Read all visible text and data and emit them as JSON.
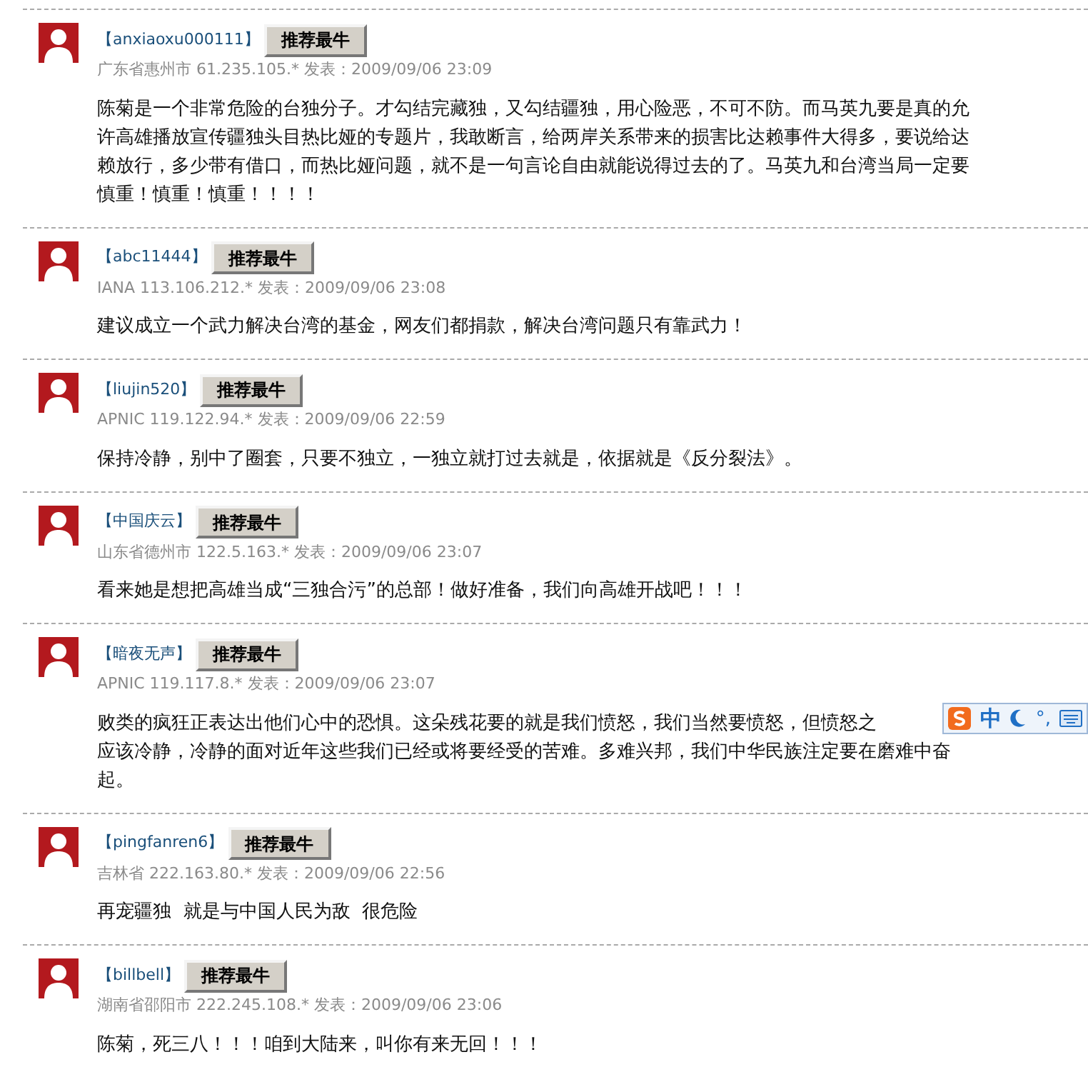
{
  "comments": [
    {
      "user": "【anxiaoxu000111】",
      "button": "推荐最牛",
      "meta": "广东省惠州市 61.235.105.* 发表：2009/09/06 23:09",
      "lines": [
        "陈菊是一个非常危险的台独分子。才勾结完藏独，又勾结疆独，用心险恶，不可不防。而马英九要是真的允",
        "许高雄播放宣传疆独头目热比娅的专题片，我敢断言，给两岸关系带来的损害比达赖事件大得多，要说给达",
        "赖放行，多少带有借口，而热比娅问题，就不是一句言论自由就能说得过去的了。马英九和台湾当局一定要",
        "慎重！慎重！慎重！！！！"
      ]
    },
    {
      "user": "【abc11444】",
      "button": "推荐最牛",
      "meta": "IANA 113.106.212.* 发表：2009/09/06 23:08",
      "lines": [
        "建议成立一个武力解决台湾的基金，网友们都捐款，解决台湾问题只有靠武力！"
      ]
    },
    {
      "user": "【liujin520】",
      "button": "推荐最牛",
      "meta": "APNIC 119.122.94.* 发表：2009/09/06 22:59",
      "lines": [
        "保持冷静，别中了圈套，只要不独立，一独立就打过去就是，依据就是《反分裂法》。"
      ]
    },
    {
      "user": "【中国庆云】",
      "button": "推荐最牛",
      "meta": "山东省德州市 122.5.163.* 发表：2009/09/06 23:07",
      "lines": [
        "看来她是想把高雄当成“三独合污”的总部！做好准备，我们向高雄开战吧！！！"
      ]
    },
    {
      "user": "【暗夜无声】",
      "button": "推荐最牛",
      "meta": "APNIC 119.117.8.* 发表：2009/09/06 23:07",
      "lines": [
        "败类的疯狂正表达出他们心中的恐惧。这朵残花要的就是我们愤怒，我们当然要愤怒，但愤怒之",
        "应该冷静，冷静的面对近年这些我们已经或将要经受的苦难。多难兴邦，我们中华民族注定要在磨难中奋",
        "起。"
      ],
      "ime": {
        "mode": "中",
        "punct": "°,"
      }
    },
    {
      "user": "【pingfanren6】",
      "button": "推荐最牛",
      "meta": "吉林省 222.163.80.* 发表：2009/09/06 22:56",
      "lines": [
        "再宠疆独  就是与中国人民为敌  很危险"
      ]
    },
    {
      "user": "【billbell】",
      "button": "推荐最牛",
      "meta": "湖南省邵阳市 222.245.108.* 发表：2009/09/06 23:06",
      "lines": [
        "陈菊，死三八！！！咱到大陆来，叫你有来无回！！！"
      ]
    }
  ]
}
